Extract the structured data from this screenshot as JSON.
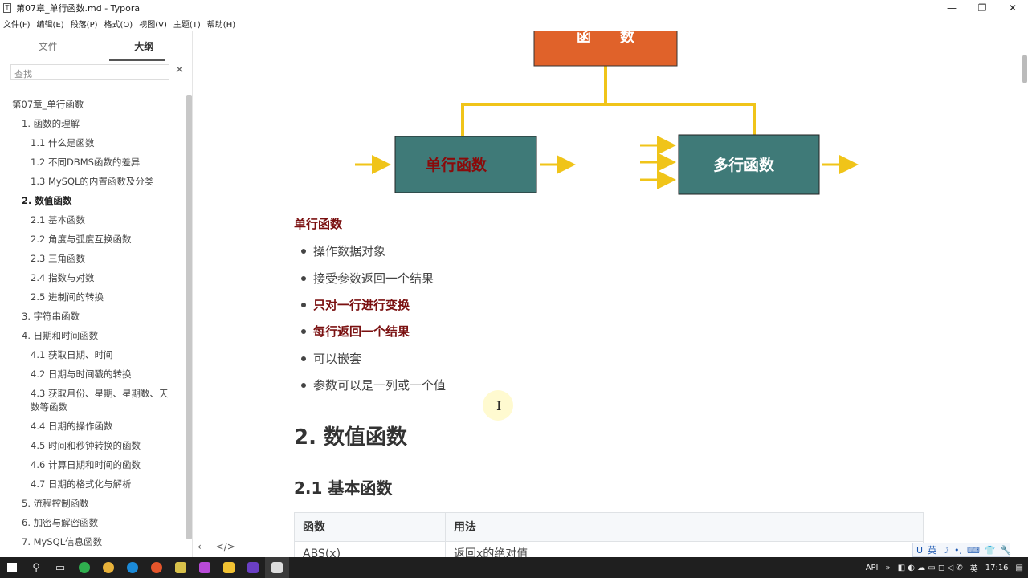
{
  "window": {
    "title": "第07章_单行函数.md - Typora",
    "controls": [
      "—",
      "❐",
      "✕"
    ]
  },
  "menu": [
    "文件(F)",
    "编辑(E)",
    "段落(P)",
    "格式(O)",
    "视图(V)",
    "主题(T)",
    "帮助(H)"
  ],
  "sidebar": {
    "tabs": [
      "文件",
      "大纲"
    ],
    "active_tab": "大纲",
    "search_placeholder": "查找",
    "outline": [
      {
        "text": "第07章_单行函数",
        "level": 0,
        "bold": false
      },
      {
        "text": "1. 函数的理解",
        "level": 1,
        "bold": false
      },
      {
        "text": "1.1 什么是函数",
        "level": 2,
        "bold": false
      },
      {
        "text": "1.2 不同DBMS函数的差异",
        "level": 2,
        "bold": false
      },
      {
        "text": "1.3 MySQL的内置函数及分类",
        "level": 2,
        "bold": false
      },
      {
        "text": "2. 数值函数",
        "level": 1,
        "bold": true
      },
      {
        "text": "2.1 基本函数",
        "level": 2,
        "bold": false
      },
      {
        "text": "2.2 角度与弧度互换函数",
        "level": 2,
        "bold": false
      },
      {
        "text": "2.3 三角函数",
        "level": 2,
        "bold": false
      },
      {
        "text": "2.4 指数与对数",
        "level": 2,
        "bold": false
      },
      {
        "text": "2.5 进制间的转换",
        "level": 2,
        "bold": false
      },
      {
        "text": "3. 字符串函数",
        "level": 1,
        "bold": false
      },
      {
        "text": "4. 日期和时间函数",
        "level": 1,
        "bold": false
      },
      {
        "text": "4.1 获取日期、时间",
        "level": 2,
        "bold": false
      },
      {
        "text": "4.2 日期与时间戳的转换",
        "level": 2,
        "bold": false
      },
      {
        "text": "4.3 获取月份、星期、星期数、天",
        "text2": "数等函数",
        "level": 2,
        "bold": false
      },
      {
        "text": "4.4 日期的操作函数",
        "level": 2,
        "bold": false
      },
      {
        "text": "4.5 时间和秒钟转换的函数",
        "level": 2,
        "bold": false
      },
      {
        "text": "4.6 计算日期和时间的函数",
        "level": 2,
        "bold": false
      },
      {
        "text": "4.7 日期的格式化与解析",
        "level": 2,
        "bold": false
      },
      {
        "text": "5. 流程控制函数",
        "level": 1,
        "bold": false
      },
      {
        "text": "6. 加密与解密函数",
        "level": 1,
        "bold": false
      },
      {
        "text": "7. MySQL信息函数",
        "level": 1,
        "bold": false
      }
    ],
    "footer_icons": [
      "‹",
      "</>"
    ]
  },
  "diagram": {
    "top_box": "函　　数",
    "left_box": "单行函数",
    "right_box": "多行函数",
    "colors": {
      "top_box": "#e0622a",
      "lower_boxes": "#3f7a78",
      "arrows": "#f0c419"
    }
  },
  "content": {
    "section_heading": "单行函数",
    "bullets": [
      {
        "text": "操作数据对象",
        "bold": false
      },
      {
        "text": "接受参数返回一个结果",
        "bold": false
      },
      {
        "text": "只对一行进行变换",
        "bold": true
      },
      {
        "text": "每行返回一个结果",
        "bold": true
      },
      {
        "text": "可以嵌套",
        "bold": false
      },
      {
        "text": "参数可以是一列或一个值",
        "bold": false
      }
    ],
    "h2": "2. 数值函数",
    "h3": "2.1 基本函数",
    "table": {
      "headers": [
        "函数",
        "用法"
      ],
      "rows": [
        [
          "ABS(x)",
          "返回x的绝对值"
        ]
      ]
    }
  },
  "ime_bar": [
    "U",
    "英",
    "☽",
    "•,",
    "⌨",
    "👕",
    "🔧"
  ],
  "taskbar": {
    "right": [
      "API",
      "»",
      "英",
      "17:16"
    ]
  }
}
